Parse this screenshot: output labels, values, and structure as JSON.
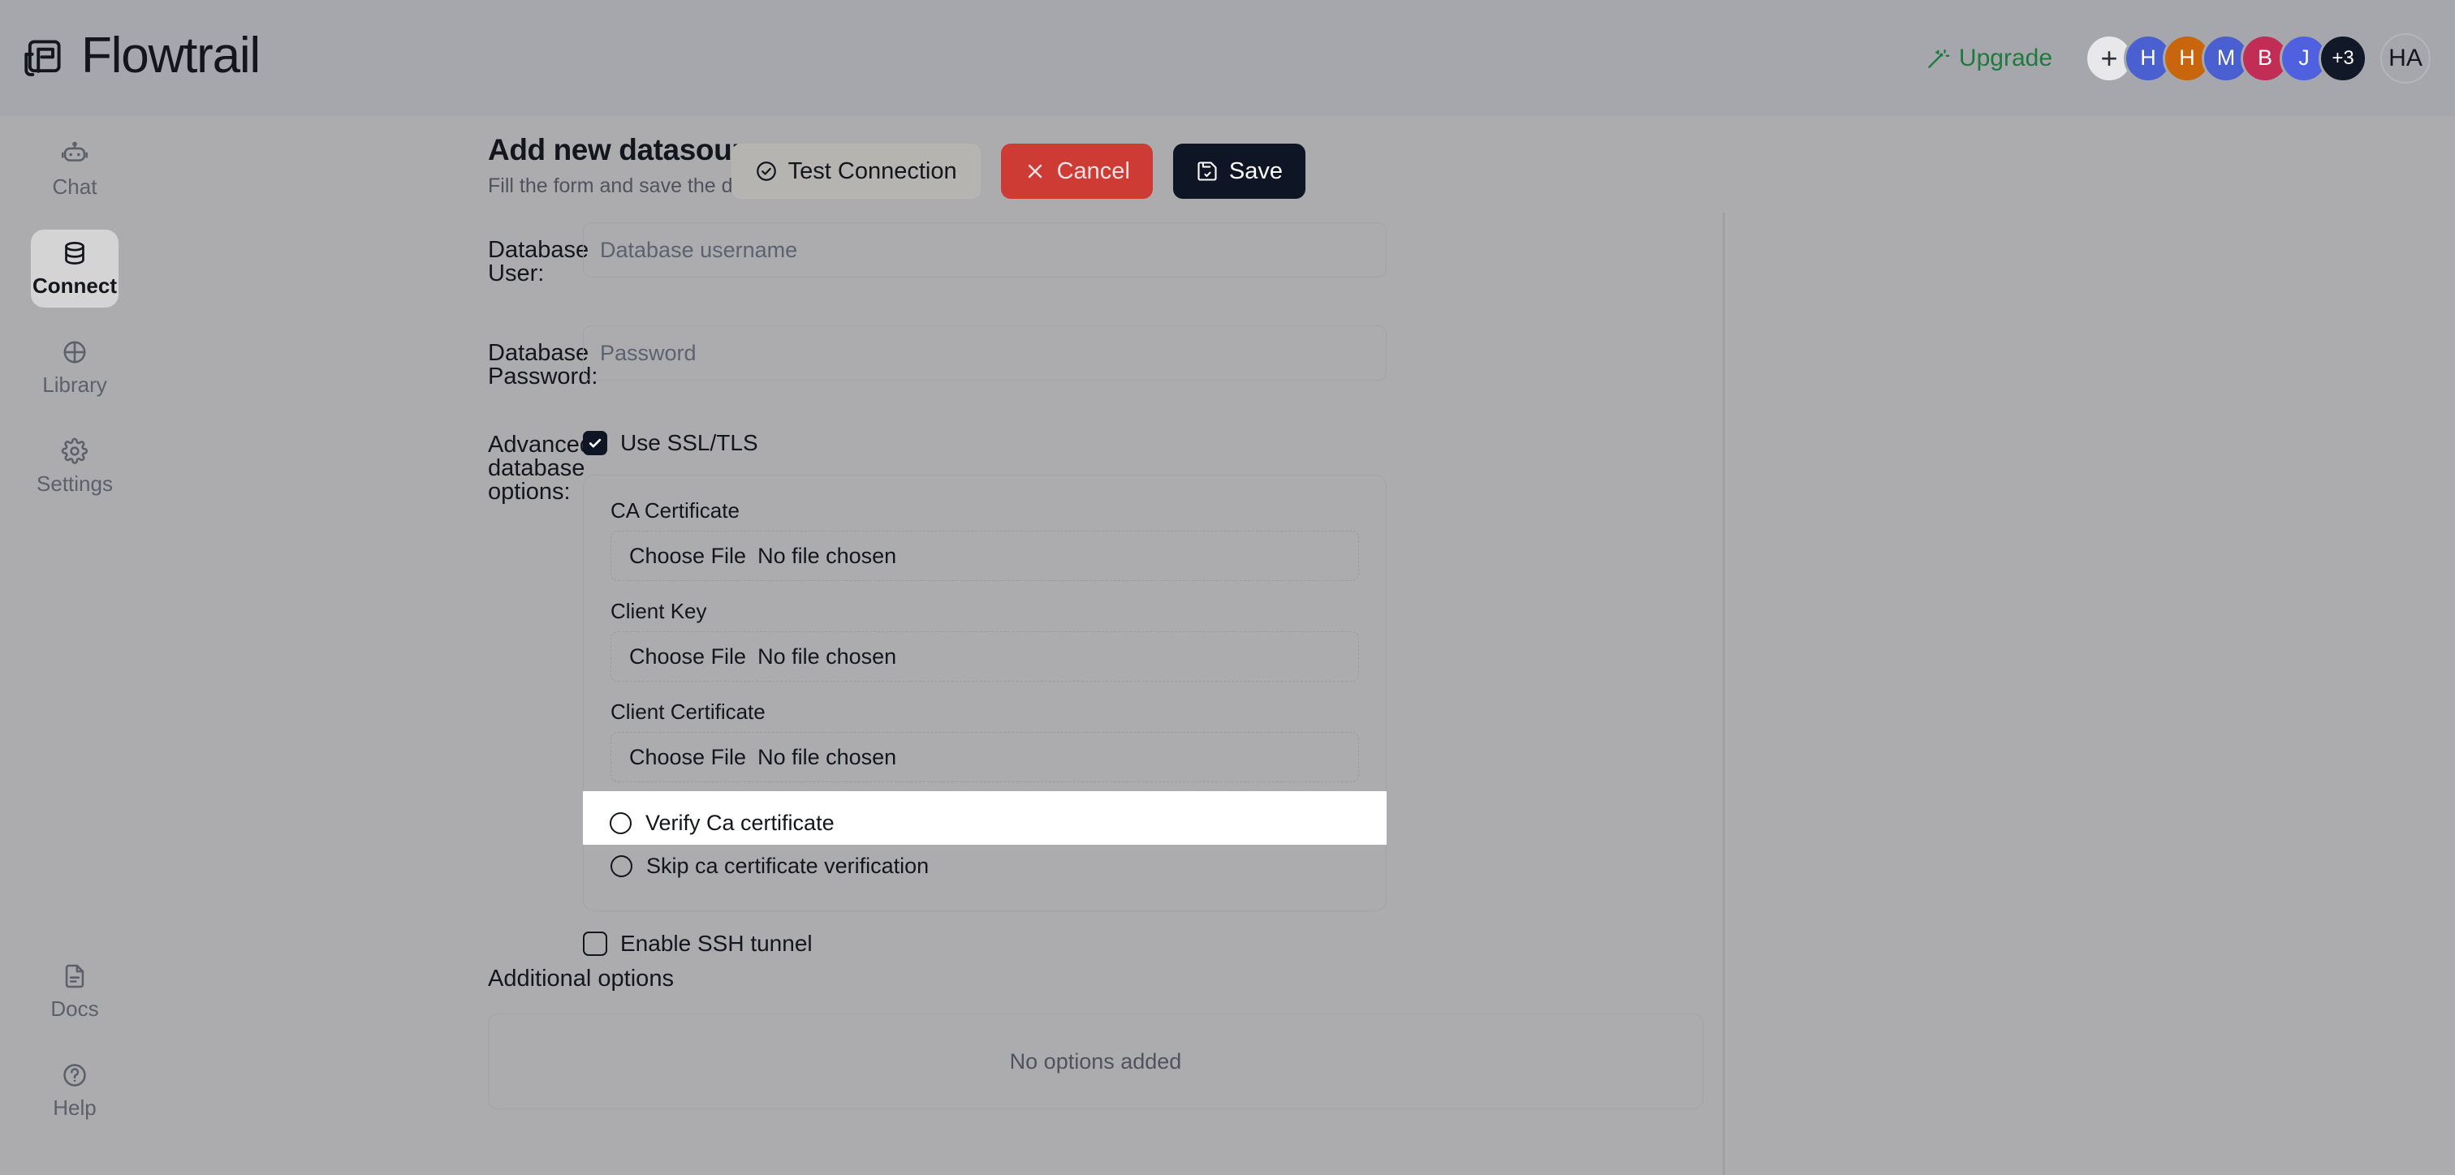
{
  "app": {
    "brand_name": "Flowtrail",
    "brand_icon": "flowtrail-logo-icon"
  },
  "topbar": {
    "upgrade_label": "Upgrade",
    "upgrade_icon": "magic-wand-icon",
    "upgrade_color": "#1f7a3d",
    "add_member_label": "+",
    "avatars": [
      {
        "initial": "H",
        "color": "#4a5fd0"
      },
      {
        "initial": "H",
        "color": "#C8650D"
      },
      {
        "initial": "M",
        "color": "#4a5fd0"
      },
      {
        "initial": "B",
        "color": "#C22D55"
      },
      {
        "initial": "J",
        "color": "#4f61de"
      }
    ],
    "overflow_label": "+3",
    "overflow_color": "#111827",
    "self_initials": "HA"
  },
  "sidebar": {
    "items": [
      {
        "label": "Chat",
        "icon": "robot-icon",
        "active": false
      },
      {
        "label": "Connect",
        "icon": "database-icon",
        "active": true
      },
      {
        "label": "Library",
        "icon": "library-icon",
        "active": false
      },
      {
        "label": "Settings",
        "icon": "gear-icon",
        "active": false
      }
    ],
    "bottom_items": [
      {
        "label": "Docs",
        "icon": "document-icon"
      },
      {
        "label": "Help",
        "icon": "question-circle-icon"
      }
    ]
  },
  "header": {
    "title": "Add new datasource",
    "subtitle": "Fill the form and save the datasource.",
    "actions": {
      "test_label": "Test Connection",
      "test_icon": "check-circle-icon",
      "cancel_label": "Cancel",
      "cancel_icon": "close-x-icon",
      "cancel_color": "#CE3B35",
      "save_label": "Save",
      "save_icon": "save-disk-icon",
      "save_color": "#0E1524"
    }
  },
  "form": {
    "db_user": {
      "label": "Database User:",
      "value": "",
      "placeholder": "Database username"
    },
    "db_password": {
      "label": "Database Password:",
      "value": "",
      "placeholder": "Password"
    },
    "advanced": {
      "label": "Advanced database options:",
      "ssl_toggle_label": "Use SSL/TLS",
      "ssl_checked": true,
      "files": [
        {
          "label": "CA Certificate",
          "button": "Choose File",
          "status": "No file chosen"
        },
        {
          "label": "Client Key",
          "button": "Choose File",
          "status": "No file chosen"
        },
        {
          "label": "Client Certificate",
          "button": "Choose File",
          "status": "No file chosen"
        }
      ],
      "radios": [
        {
          "label": "Verify Ca certificate",
          "selected": false,
          "highlighted": true
        },
        {
          "label": "Skip ca certificate verification",
          "selected": false,
          "highlighted": false
        }
      ]
    },
    "ssh": {
      "toggle_label": "Enable SSH tunnel",
      "checked": false
    },
    "additional": {
      "title": "Additional options",
      "empty_text": "No options added"
    }
  }
}
